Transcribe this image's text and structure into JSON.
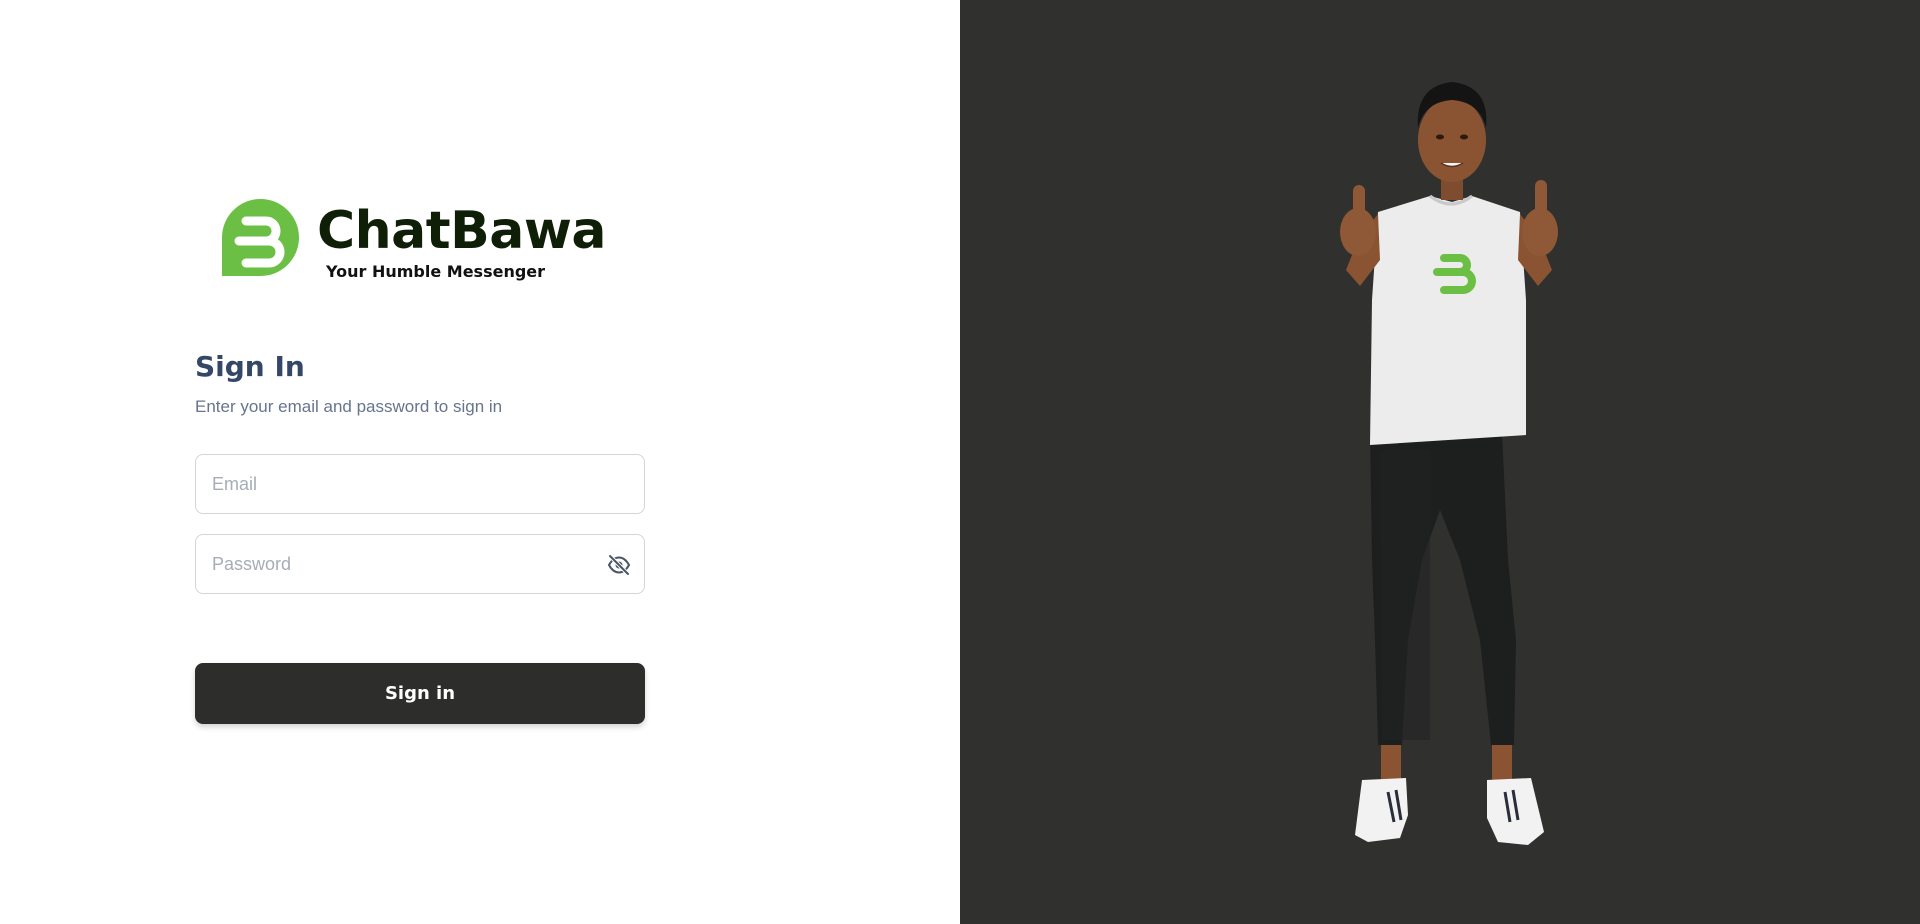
{
  "brand": {
    "name": "ChatBawa",
    "tagline": "Your Humble Messenger",
    "accent_color": "#6bbf44",
    "wordmark_color": "#0f1f07"
  },
  "signin": {
    "title": "Sign In",
    "subtitle": "Enter your email and password to sign in",
    "email_placeholder": "Email",
    "password_placeholder": "Password",
    "password_toggle_icon": "eye-off-icon",
    "submit_label": "Sign in",
    "button_color": "#2d2e2c"
  },
  "hero": {
    "background_color": "#30312f",
    "illustration": "person-thumbs-up-illustration"
  }
}
